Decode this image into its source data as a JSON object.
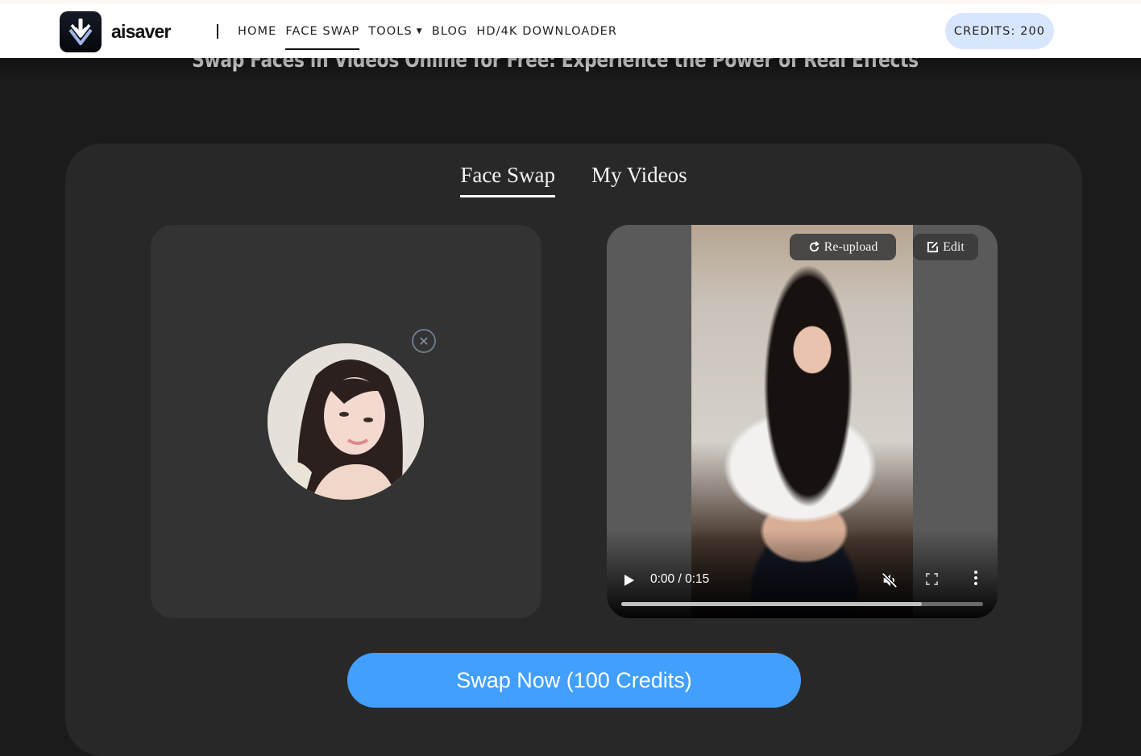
{
  "header": {
    "brand": "aisaver",
    "nav": [
      {
        "label": "HOME",
        "active": false
      },
      {
        "label": "FACE SWAP",
        "active": true
      },
      {
        "label": "TOOLS",
        "active": false,
        "has_dropdown": true
      },
      {
        "label": "BLOG",
        "active": false
      },
      {
        "label": "HD/4K DOWNLOADER",
        "active": false
      }
    ],
    "credits_label": "CREDITS: 200"
  },
  "hero": {
    "title": "Swap Faces in Videos Online for Free: Experience the Power of Real Effects"
  },
  "tabs": [
    {
      "label": "Face Swap",
      "active": true
    },
    {
      "label": "My Videos",
      "active": false
    }
  ],
  "face_upload": {
    "image_alt": "uploaded face photo",
    "remove_icon": "close-circle-icon",
    "remove_glyph": "✕"
  },
  "video": {
    "reupload_label": "Re-upload",
    "edit_label": "Edit",
    "time": "0:00 / 0:15",
    "buffered_fraction": 0.83,
    "muted": true
  },
  "action": {
    "swap_label": "Swap Now (100 Credits)"
  },
  "colors": {
    "accent": "#429ffd",
    "credits_bg": "#d8e6fd",
    "panel_bg": "#282828",
    "page_bg": "#1b1b1b"
  }
}
